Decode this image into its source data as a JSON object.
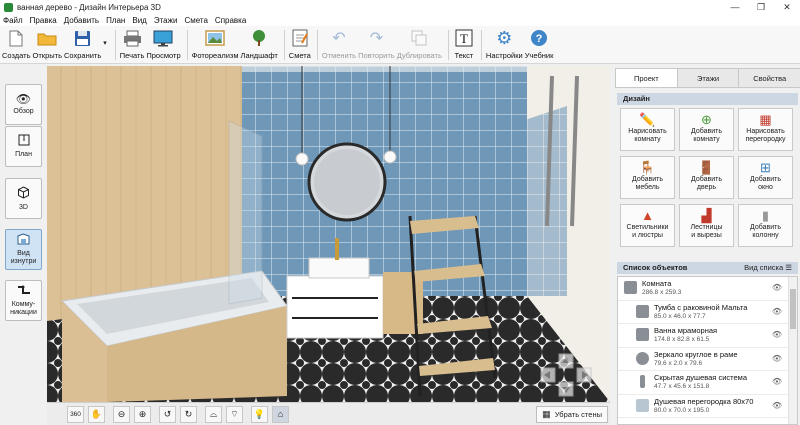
{
  "window": {
    "title": "ванная дерево - Дизайн Интерьера 3D",
    "controls": [
      "—",
      "❐",
      "✕"
    ]
  },
  "menu": [
    "Файл",
    "Правка",
    "Добавить",
    "План",
    "Вид",
    "Этажи",
    "Смета",
    "Справка"
  ],
  "toolbar": {
    "create": "Создать",
    "open": "Открыть",
    "save": "Сохранить",
    "print": "Печать",
    "preview": "Просмотр",
    "photoreal": "Фотореализм",
    "landscape": "Ландшафт",
    "estimate": "Смета",
    "undo": "Отменить",
    "redo": "Повторить",
    "duplicate": "Дублировать",
    "text": "Текст",
    "settings": "Настройки",
    "tutorial": "Учебник"
  },
  "leftbar": {
    "overview": "Обзор",
    "plan": "План",
    "view3d": "3D",
    "inside_line1": "Вид",
    "inside_line2": "изнутри",
    "comm_line1": "Комму-",
    "comm_line2": "никации"
  },
  "bottombar": {
    "rotate360": "360",
    "remove_walls": "Убрать стены"
  },
  "tabs": [
    "Проект",
    "Этажи",
    "Свойства"
  ],
  "design": {
    "title": "Дизайн",
    "buttons": [
      {
        "l1": "Нарисовать",
        "l2": "комнату"
      },
      {
        "l1": "Добавить",
        "l2": "комнату"
      },
      {
        "l1": "Нарисовать",
        "l2": "перегородку"
      },
      {
        "l1": "Добавить",
        "l2": "мебель"
      },
      {
        "l1": "Добавить",
        "l2": "дверь"
      },
      {
        "l1": "Добавить",
        "l2": "окно"
      },
      {
        "l1": "Светильники",
        "l2": "и люстры"
      },
      {
        "l1": "Лестницы",
        "l2": "и вырезы"
      },
      {
        "l1": "Добавить",
        "l2": "колонну"
      }
    ]
  },
  "objects": {
    "title": "Список объектов",
    "view_list": "Вид списка",
    "items": [
      {
        "name": "Комната",
        "dim": "286.8 x 259.3"
      },
      {
        "name": "Тумба с раковиной Мальта",
        "dim": "85.0 x 46.0 x 77.7"
      },
      {
        "name": "Ванна мраморная",
        "dim": "174.8 x 82.8 x 61.5"
      },
      {
        "name": "Зеркало круглое в раме",
        "dim": "79.6 x 2.0 x 79.6"
      },
      {
        "name": "Скрытая душевая система",
        "dim": "47.7 x 45.6 x 151.8"
      },
      {
        "name": "Душевая перегородка 80x70",
        "dim": "80.0 x 70.0 x 195.0"
      }
    ]
  }
}
